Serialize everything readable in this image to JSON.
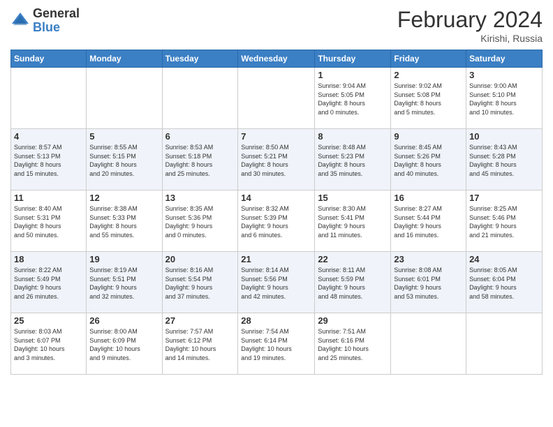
{
  "header": {
    "logo_general": "General",
    "logo_blue": "Blue",
    "month_year": "February 2024",
    "location": "Kirishi, Russia"
  },
  "days_of_week": [
    "Sunday",
    "Monday",
    "Tuesday",
    "Wednesday",
    "Thursday",
    "Friday",
    "Saturday"
  ],
  "weeks": [
    [
      {
        "day": "",
        "info": ""
      },
      {
        "day": "",
        "info": ""
      },
      {
        "day": "",
        "info": ""
      },
      {
        "day": "",
        "info": ""
      },
      {
        "day": "1",
        "info": "Sunrise: 9:04 AM\nSunset: 5:05 PM\nDaylight: 8 hours\nand 0 minutes."
      },
      {
        "day": "2",
        "info": "Sunrise: 9:02 AM\nSunset: 5:08 PM\nDaylight: 8 hours\nand 5 minutes."
      },
      {
        "day": "3",
        "info": "Sunrise: 9:00 AM\nSunset: 5:10 PM\nDaylight: 8 hours\nand 10 minutes."
      }
    ],
    [
      {
        "day": "4",
        "info": "Sunrise: 8:57 AM\nSunset: 5:13 PM\nDaylight: 8 hours\nand 15 minutes."
      },
      {
        "day": "5",
        "info": "Sunrise: 8:55 AM\nSunset: 5:15 PM\nDaylight: 8 hours\nand 20 minutes."
      },
      {
        "day": "6",
        "info": "Sunrise: 8:53 AM\nSunset: 5:18 PM\nDaylight: 8 hours\nand 25 minutes."
      },
      {
        "day": "7",
        "info": "Sunrise: 8:50 AM\nSunset: 5:21 PM\nDaylight: 8 hours\nand 30 minutes."
      },
      {
        "day": "8",
        "info": "Sunrise: 8:48 AM\nSunset: 5:23 PM\nDaylight: 8 hours\nand 35 minutes."
      },
      {
        "day": "9",
        "info": "Sunrise: 8:45 AM\nSunset: 5:26 PM\nDaylight: 8 hours\nand 40 minutes."
      },
      {
        "day": "10",
        "info": "Sunrise: 8:43 AM\nSunset: 5:28 PM\nDaylight: 8 hours\nand 45 minutes."
      }
    ],
    [
      {
        "day": "11",
        "info": "Sunrise: 8:40 AM\nSunset: 5:31 PM\nDaylight: 8 hours\nand 50 minutes."
      },
      {
        "day": "12",
        "info": "Sunrise: 8:38 AM\nSunset: 5:33 PM\nDaylight: 8 hours\nand 55 minutes."
      },
      {
        "day": "13",
        "info": "Sunrise: 8:35 AM\nSunset: 5:36 PM\nDaylight: 9 hours\nand 0 minutes."
      },
      {
        "day": "14",
        "info": "Sunrise: 8:32 AM\nSunset: 5:39 PM\nDaylight: 9 hours\nand 6 minutes."
      },
      {
        "day": "15",
        "info": "Sunrise: 8:30 AM\nSunset: 5:41 PM\nDaylight: 9 hours\nand 11 minutes."
      },
      {
        "day": "16",
        "info": "Sunrise: 8:27 AM\nSunset: 5:44 PM\nDaylight: 9 hours\nand 16 minutes."
      },
      {
        "day": "17",
        "info": "Sunrise: 8:25 AM\nSunset: 5:46 PM\nDaylight: 9 hours\nand 21 minutes."
      }
    ],
    [
      {
        "day": "18",
        "info": "Sunrise: 8:22 AM\nSunset: 5:49 PM\nDaylight: 9 hours\nand 26 minutes."
      },
      {
        "day": "19",
        "info": "Sunrise: 8:19 AM\nSunset: 5:51 PM\nDaylight: 9 hours\nand 32 minutes."
      },
      {
        "day": "20",
        "info": "Sunrise: 8:16 AM\nSunset: 5:54 PM\nDaylight: 9 hours\nand 37 minutes."
      },
      {
        "day": "21",
        "info": "Sunrise: 8:14 AM\nSunset: 5:56 PM\nDaylight: 9 hours\nand 42 minutes."
      },
      {
        "day": "22",
        "info": "Sunrise: 8:11 AM\nSunset: 5:59 PM\nDaylight: 9 hours\nand 48 minutes."
      },
      {
        "day": "23",
        "info": "Sunrise: 8:08 AM\nSunset: 6:01 PM\nDaylight: 9 hours\nand 53 minutes."
      },
      {
        "day": "24",
        "info": "Sunrise: 8:05 AM\nSunset: 6:04 PM\nDaylight: 9 hours\nand 58 minutes."
      }
    ],
    [
      {
        "day": "25",
        "info": "Sunrise: 8:03 AM\nSunset: 6:07 PM\nDaylight: 10 hours\nand 3 minutes."
      },
      {
        "day": "26",
        "info": "Sunrise: 8:00 AM\nSunset: 6:09 PM\nDaylight: 10 hours\nand 9 minutes."
      },
      {
        "day": "27",
        "info": "Sunrise: 7:57 AM\nSunset: 6:12 PM\nDaylight: 10 hours\nand 14 minutes."
      },
      {
        "day": "28",
        "info": "Sunrise: 7:54 AM\nSunset: 6:14 PM\nDaylight: 10 hours\nand 19 minutes."
      },
      {
        "day": "29",
        "info": "Sunrise: 7:51 AM\nSunset: 6:16 PM\nDaylight: 10 hours\nand 25 minutes."
      },
      {
        "day": "",
        "info": ""
      },
      {
        "day": "",
        "info": ""
      }
    ]
  ]
}
